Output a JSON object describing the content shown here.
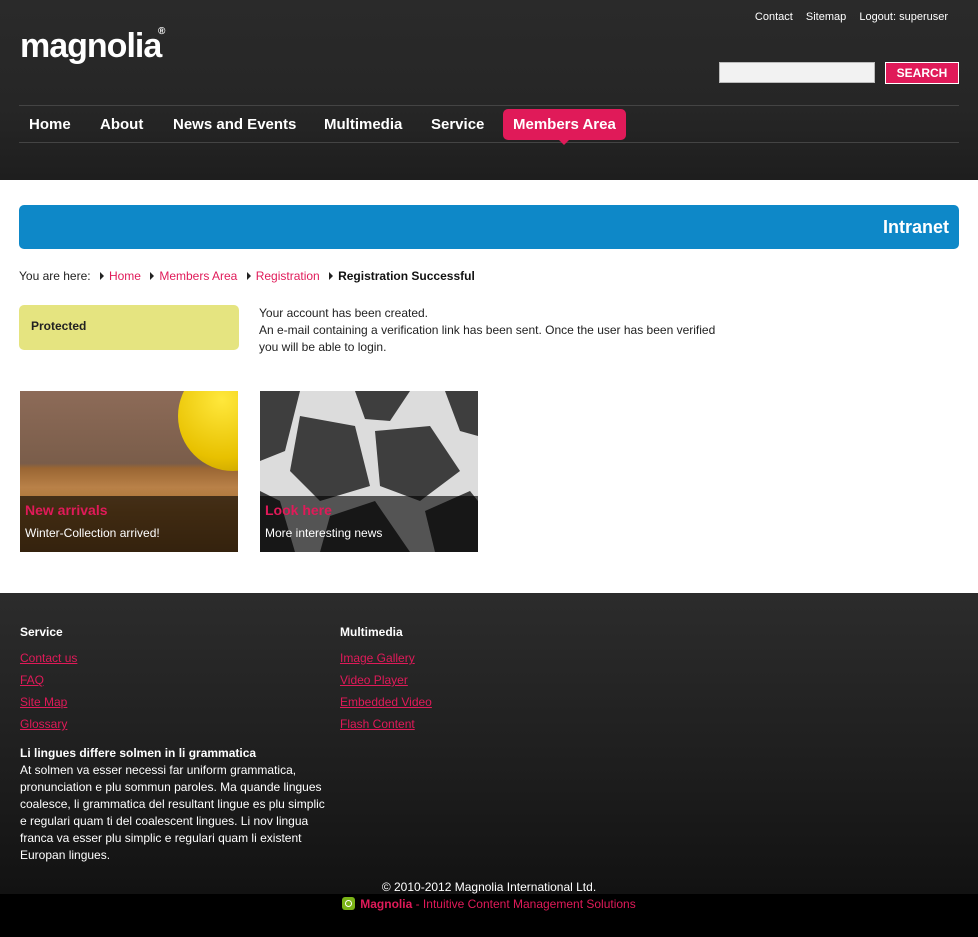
{
  "header": {
    "logo_text": "magnolia",
    "logo_reg": "®",
    "top_links": [
      "Contact",
      "Sitemap",
      "Logout: superuser"
    ],
    "search": {
      "placeholder": "",
      "button_label": "SEARCH"
    },
    "nav": [
      "Home",
      "About",
      "News and Events",
      "Multimedia",
      "Service",
      "Members Area"
    ],
    "active_nav": "Members Area"
  },
  "main": {
    "banner_title": "Intranet",
    "breadcrumb": {
      "prefix": "You are here:",
      "links": [
        "Home",
        "Members Area",
        "Registration"
      ],
      "current": "Registration Successful"
    },
    "protected_label": "Protected",
    "message": {
      "line1": "Your account has been created.",
      "line2": "An e-mail containing a verification link has been sent. Once the user has been verified you will be able to login."
    },
    "teasers": [
      {
        "title": "New arrivals",
        "description": "Winter-Collection arrived!"
      },
      {
        "title": "Look here",
        "description": "More interesting news"
      }
    ]
  },
  "footer": {
    "columns": [
      {
        "heading": "Service",
        "links": [
          "Contact us",
          "FAQ",
          "Site Map",
          "Glossary"
        ]
      },
      {
        "heading": "Multimedia",
        "links": [
          "Image Gallery",
          "Video Player",
          "Embedded Video",
          "Flash Content"
        ]
      }
    ],
    "text_heading": "Li lingues differe solmen in li grammatica",
    "text_body": "At solmen va esser necessi far uniform grammatica, pronunciation e plu sommun paroles. Ma quande lingues coalesce, li grammatica del resultant lingue es plu simplic e regulari quam ti del coalescent lingues. Li nov lingua franca va esser plu simplic e regulari quam li existent Europan lingues.",
    "copyright": "© 2010-2012 Magnolia International Ltd.",
    "powered_brand": "Magnolia",
    "powered_text": " - Intuitive Content Management Solutions"
  },
  "colors": {
    "accent": "#e01a59",
    "banner": "#0e88c8",
    "protected_bg": "#e5e480",
    "header_bg": "#262626"
  }
}
